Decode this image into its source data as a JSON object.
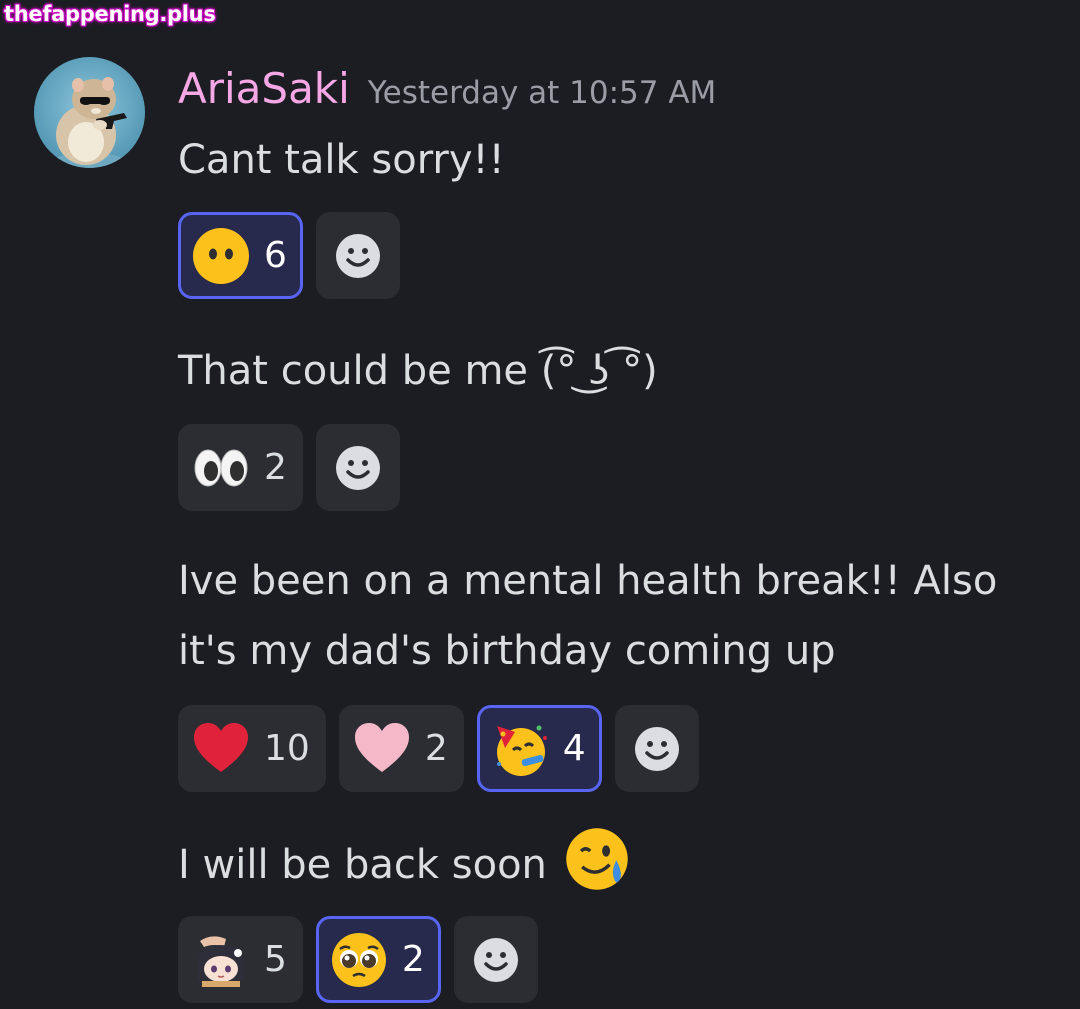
{
  "watermark": "thefappening.plus",
  "author": {
    "name": "AriaSaki",
    "timestamp": "Yesterday at 10:57 AM"
  },
  "messages": [
    {
      "text": "Cant talk sorry!!",
      "reactions": [
        {
          "emoji": "no-mouth-face-icon",
          "count": "6",
          "selected": true
        }
      ]
    },
    {
      "text": "That could be me (͡° ͜ʖ ͡°)",
      "reactions": [
        {
          "emoji": "eyes-icon",
          "count": "2",
          "selected": false
        }
      ]
    },
    {
      "text": "Ive been on a mental health break!! Also it's my dad's birthday coming up",
      "reactions": [
        {
          "emoji": "red-heart-icon",
          "count": "10",
          "selected": false
        },
        {
          "emoji": "pink-heart-icon",
          "count": "2",
          "selected": false
        },
        {
          "emoji": "partying-face-icon",
          "count": "4",
          "selected": true
        }
      ]
    },
    {
      "text": "I will be back soon",
      "trailing_emoji": "crying-smile-face-icon",
      "reactions": [
        {
          "emoji": "custom-anime-headpat-emoji-icon",
          "count": "5",
          "selected": false
        },
        {
          "emoji": "pleading-face-icon",
          "count": "2",
          "selected": true
        }
      ]
    }
  ],
  "colors": {
    "background": "#1c1d22",
    "username": "#f6a8e6",
    "accent": "#5865f2"
  }
}
